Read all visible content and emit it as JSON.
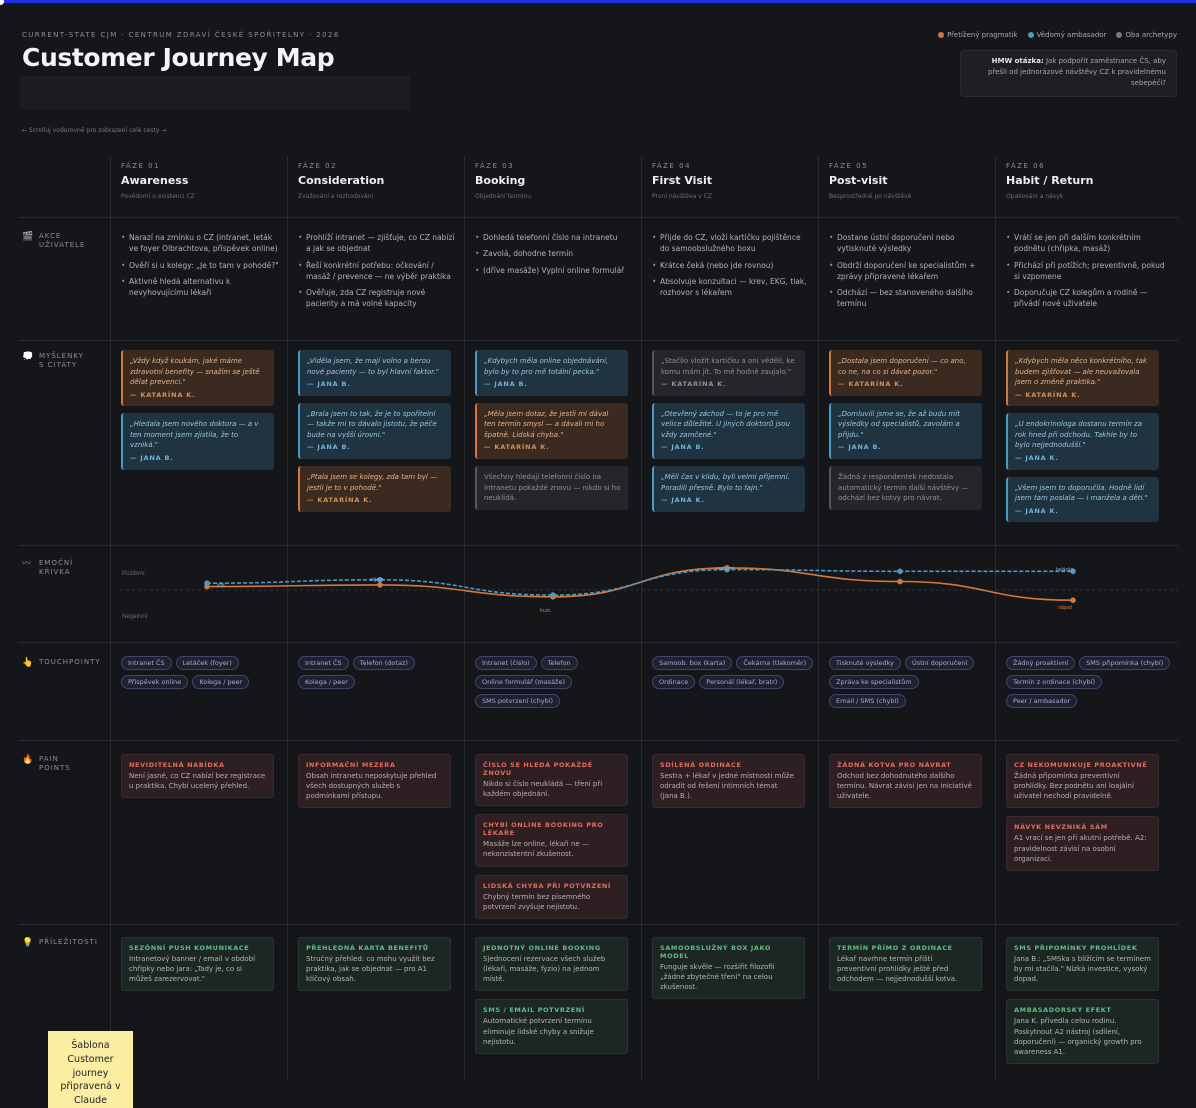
{
  "header": {
    "eyebrow": "CURRENT-STATE CJM · CENTRUM ZDRAVÍ ČESKÉ SPOŘITELNY · 2026",
    "title": "Customer Journey Map",
    "scroll_hint": "← Scrolluj vodorovně pro zobrazení celé cesty →"
  },
  "legend": [
    {
      "label": "Přetížený pragmatik",
      "color": "#d4773a"
    },
    {
      "label": "Vědomý ambasador",
      "color": "#4a9bc4"
    },
    {
      "label": "Oba archetypy",
      "color": "#7a7b82"
    }
  ],
  "hmw": {
    "label": "HMW otázka:",
    "text": "Jak podpořit zaměstnance ČS, aby přešli od jednorázové návštěvy CZ k pravidelnému sebepéči?"
  },
  "phases": [
    {
      "num": "FÁZE 01",
      "name": "Awareness",
      "sub": "Povědomí o existenci CZ"
    },
    {
      "num": "FÁZE 02",
      "name": "Consideration",
      "sub": "Zvažování a rozhodování"
    },
    {
      "num": "FÁZE 03",
      "name": "Booking",
      "sub": "Objednání termínu"
    },
    {
      "num": "FÁZE 04",
      "name": "First Visit",
      "sub": "První návštěva v CZ"
    },
    {
      "num": "FÁZE 05",
      "name": "Post-visit",
      "sub": "Bezprostředně po návštěvě"
    },
    {
      "num": "FÁZE 06",
      "name": "Habit / Return",
      "sub": "Opakování a návyk"
    }
  ],
  "rows": {
    "actions": {
      "label1": "AKCE",
      "label2": "UŽIVATELE"
    },
    "thoughts": {
      "label1": "MYŠLENKY",
      "label2": "S CITÁTY"
    },
    "emotion": {
      "label1": "EMOČNÍ",
      "label2": "KŘIVKA"
    },
    "touch": {
      "label1": "TOUCHPOINTY",
      "label2": ""
    },
    "pain": {
      "label1": "PAIN",
      "label2": "POINTS"
    },
    "opp": {
      "label1": "PŘÍLEŽITOSTI",
      "label2": ""
    }
  },
  "actions": [
    [
      "Narazí na zmínku o CZ (intranet, leták ve foyer Olbrachtova, příspěvek online)",
      "Ověří si u kolegy: „Je to tam v pohodě?\"",
      "Aktivně hledá alternativu k nevyhovujícímu lékaři"
    ],
    [
      "Prohlíží intranet — zjišťuje, co CZ nabízí a jak se objednat",
      "Řeší konkrétní potřebu: očkování / masáž / prevence — ne výběr praktika",
      "Ověřuje, zda CZ registruje nové pacienty a má volné kapacity"
    ],
    [
      "Dohledá telefonní číslo na intranetu",
      "Zavolá, dohodne termín",
      "(dříve masáže) Vyplní online formulář"
    ],
    [
      "Přijde do CZ, vloží kartičku pojištěnce do samoobslužného boxu",
      "Krátce čeká (nebo jde rovnou)",
      "Absolvuje konzultaci — krev, EKG, tlak, rozhovor s lékařem"
    ],
    [
      "Dostane ústní doporučení nebo vytisknuté výsledky",
      "Obdrží doporučení ke specialistům + zprávy připravené lékařem",
      "Odchází — bez stanoveného dalšího termínu"
    ],
    [
      "Vrátí se jen při dalším konkrétním podnětu (chřipka, masáž)",
      "Přichází při potížích; preventivně, pokud si vzpomene",
      "Doporučuje CZ kolegům a rodině — přivádí nové uživatele"
    ]
  ],
  "quotes": [
    [
      {
        "type": "o",
        "text": "„Vždy když koukám, jaké máme zdravotní benefity — snažím se ještě dělat prevenci.\"",
        "who": "— KATARÍNA K."
      },
      {
        "type": "b",
        "text": "„Hledala jsem nového doktora — a v ten moment jsem zjistila, že to vzniká.\"",
        "who": "— JANA B."
      }
    ],
    [
      {
        "type": "b",
        "text": "„Viděla jsem, že mají volno a berou nové pacienty — to byl hlavní faktor.\"",
        "who": "— JANA B."
      },
      {
        "type": "b",
        "text": "„Brala jsem to tak, že je to spořitelní — takže mi to dávalo jistotu, že péče bude na vyšší úrovni.\"",
        "who": "— JANA B."
      },
      {
        "type": "o",
        "text": "„Ptala jsem se kolegy, zda tam byl — jestli je to v pohodě.\"",
        "who": "— KATARÍNA K."
      }
    ],
    [
      {
        "type": "b",
        "text": "„Kdybych měla online objednávání, bylo by to pro mě totální pecka.\"",
        "who": "— JANA B."
      },
      {
        "type": "o",
        "text": "„Měla jsem dotaz, že jestli mi dával ten termín smysl — a dávali mi ho špatně. Lidská chyba.\"",
        "who": "— KATARÍNA K."
      },
      {
        "type": "g",
        "text": "Všechny hledají telefonní číslo na intranetu pokaždé znovu — nikdo si ho neuklídá.",
        "who": ""
      }
    ],
    [
      {
        "type": "g",
        "text": "„Stačilo vložit kartičku a oni věděli, ke komu mám jít. To mě hodně zaujalo.\"",
        "who": "— KATARÍNA K."
      },
      {
        "type": "b",
        "text": "„Otevřený záchod — to je pro mě velice důležité. U jiných doktorů jsou vždy zamčené.\"",
        "who": "— JANA B."
      },
      {
        "type": "b",
        "text": "„Měli čas v klidu, byli velmi příjemní. Poradili přesně. Bylo to fajn.\"",
        "who": "— JANA K."
      }
    ],
    [
      {
        "type": "o",
        "text": "„Dostala jsem doporučení — co ano, co ne, na co si dávat pozor.\"",
        "who": "— KATARÍNA K."
      },
      {
        "type": "b",
        "text": "„Domluvili jsme se, že až budu mít výsledky od specialistů, zavolám a přijdu.\"",
        "who": "— JANA B."
      },
      {
        "type": "g",
        "text": "Žádná z respondentek nedostala automatický termín další návštěvy — odchází bez kotvy pro návrat.",
        "who": ""
      }
    ],
    [
      {
        "type": "o",
        "text": "„Kdybych měla něco konkrétního, tak budem zjišťovat — ale neuvažovala jsem o změně praktika.\"",
        "who": "— KATARÍNA K."
      },
      {
        "type": "b",
        "text": "„U endokrinologa dostanu termín za rok hned při odchodu. Takhle by to bylo nejjednodušší.\"",
        "who": "— JANA K."
      },
      {
        "type": "b",
        "text": "„Všem jsem to doporučila. Hodně lidí jsem tam poslala — i manžela a děti.\"",
        "who": "— JANA K."
      }
    ]
  ],
  "emotion": {
    "axis_top": "Pozitivní",
    "axis_bottom": "Negativní",
    "point_labels": [
      "klid",
      "zájem",
      "frust.",
      "nadšení",
      "",
      "bojácko",
      "odpad"
    ]
  },
  "touchpoints": [
    [
      "Intranet ČS",
      "Letáček (foyer)",
      "Příspěvek online",
      "Kolega / peer"
    ],
    [
      "Intranet ČS",
      "Telefon (dotaz)",
      "Kolega / peer"
    ],
    [
      "Intranet (číslo)",
      "Telefon",
      "Online formulář (masáže)",
      "SMS potvrzení (chybí)"
    ],
    [
      "Samoob. box (karta)",
      "Čekárna (tlakoměr)",
      "Ordinace",
      "Personál (lékař, bratr)"
    ],
    [
      "Tisknuté výsledky",
      "Ústní doporučení",
      "Zpráva ke specialistům",
      "Email / SMS (chybí)"
    ],
    [
      "Žádný proaktivní",
      "SMS připomínka (chybí)",
      "Termín z ordinace (chybí)",
      "Peer / ambasador"
    ]
  ],
  "pains": [
    [
      {
        "h": "NEVIDITELNÁ NABÍDKA",
        "t": "Není jasné, co CZ nabízí bez registrace u praktika. Chybí ucelený přehled."
      }
    ],
    [
      {
        "h": "INFORMAČNÍ MEZERA",
        "t": "Obsah intranetu neposkytuje přehled všech dostupných služeb s podmínkami přístupu."
      }
    ],
    [
      {
        "h": "ČÍSLO SE HLEDÁ POKAŽDÉ ZNOVU",
        "t": "Nikdo si číslo neukládá — tření při každém objednání."
      },
      {
        "h": "CHYBÍ ONLINE BOOKING PRO LÉKAŘE",
        "t": "Masáže lze online, lékaři ne — nekonzistentní zkušenost."
      },
      {
        "h": "LIDSKÁ CHYBA PŘI POTVRZENÍ",
        "t": "Chybný termín bez písemného potvrzení zvyšuje nejistotu."
      }
    ],
    [
      {
        "h": "SDÍLENÁ ORDINACE",
        "t": "Sestra + lékař v jedné místnosti může odradit od řešení intimních témat (Jana B.)."
      }
    ],
    [
      {
        "h": "ŽÁDNÁ KOTVA PRO NÁVRAT",
        "t": "Odchod bez dohodnutého dalšího termínu. Návrat závisí jen na iniciativě uživatele."
      }
    ],
    [
      {
        "h": "CZ NEKOMUNIKUJE PROAKTIVNĚ",
        "t": "Žádná připomínka preventivní prohlídky. Bez podnětu ani loajální uživatel nechodí pravidelně."
      },
      {
        "h": "NÁVYK NEVZNIKÁ SÁM",
        "t": "A1 vrací se jen při akutní potřebě. A2: pravidelnost závisí na osobní organizaci."
      }
    ]
  ],
  "opps": [
    [
      {
        "h": "SEZÓNNÍ PUSH KOMUNIKACE",
        "t": "Intranetový banner / email v období chřipky nebo jara: „Tady je, co si můžeš zarezervovat.\""
      }
    ],
    [
      {
        "h": "PŘEHLEDNÁ KARTA BENEFITŮ",
        "t": "Stručný přehled: co mohu využít bez praktika, jak se objednat — pro A1 klíčový obsah."
      }
    ],
    [
      {
        "h": "JEDNOTNÝ ONLINE BOOKING",
        "t": "Sjednocení rezervace všech služeb (lékaři, masáže, fyzio) na jednom místě."
      },
      {
        "h": "SMS / EMAIL POTVRZENÍ",
        "t": "Automatické potvrzení termínu eliminuje lidské chyby a snižuje nejistotu."
      }
    ],
    [
      {
        "h": "SAMOOBSLUŽNÝ BOX JAKO MODEL",
        "t": "Funguje skvěle — rozšířit filozofii „žádné zbytečné tření\" na celou zkušenost."
      }
    ],
    [
      {
        "h": "TERMÍN PŘÍMO Z ORDINACE",
        "t": "Lékař navrhne termín příští preventivní prohlídky ještě před odchodem — nejjednodušší kotva."
      }
    ],
    [
      {
        "h": "SMS PŘIPOMÍNKY PROHLÍDEK",
        "t": "Jana B.: „SMSka s blížícím se termínem by mi stačila.\" Nízká investice, vysoký dopad."
      },
      {
        "h": "AMBASADORSKÝ EFEKT",
        "t": "Jana K. přivedla celou rodinu. Poskytnout A2 nástroj (sdílení, doporučení) — organický growth pro awareness A1."
      }
    ]
  ],
  "sticky": "Šablona Customer journey připravená v Claude",
  "chart_data": {
    "type": "line",
    "x": [
      "Awareness",
      "Consideration",
      "Booking",
      "First Visit",
      "Post-visit",
      "Habit / Return"
    ],
    "ylim": [
      -1,
      1
    ],
    "series": [
      {
        "name": "Přetížený pragmatik",
        "color": "#d4773a",
        "values": [
          0.1,
          0.15,
          -0.2,
          0.65,
          0.25,
          -0.3
        ]
      },
      {
        "name": "Vědomý ambasador",
        "color": "#4a9bc4",
        "values": [
          0.2,
          0.3,
          -0.15,
          0.6,
          0.55,
          0.55
        ]
      }
    ]
  }
}
